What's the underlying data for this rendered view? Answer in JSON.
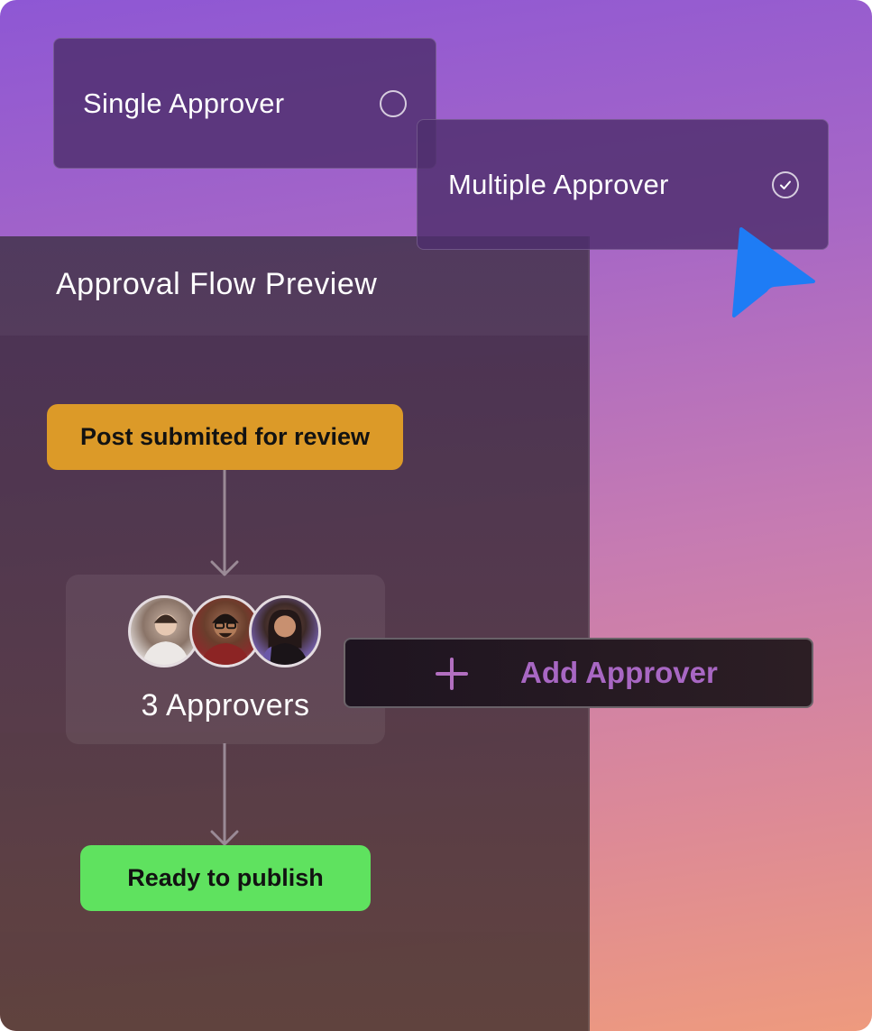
{
  "options": {
    "single": {
      "label": "Single Approver",
      "selected": false,
      "icon": "radio-empty-icon"
    },
    "multiple": {
      "label": "Multiple Approver",
      "selected": true,
      "icon": "check-circle-icon"
    }
  },
  "cursor": {
    "icon": "pointer-cursor-icon",
    "color": "#1e7cf5"
  },
  "panel": {
    "title": "Approval Flow Preview",
    "steps": {
      "review": {
        "label": "Post submited for review",
        "color": "#dc9a28"
      },
      "approvers": {
        "count_label": "3 Approvers",
        "avatars": [
          "avatar-1",
          "avatar-2",
          "avatar-3"
        ]
      },
      "ready": {
        "label": "Ready to publish",
        "color": "#5fe25f"
      }
    }
  },
  "add_approver": {
    "label": "Add Approver",
    "icon": "plus-icon",
    "color": "#a867c3"
  }
}
